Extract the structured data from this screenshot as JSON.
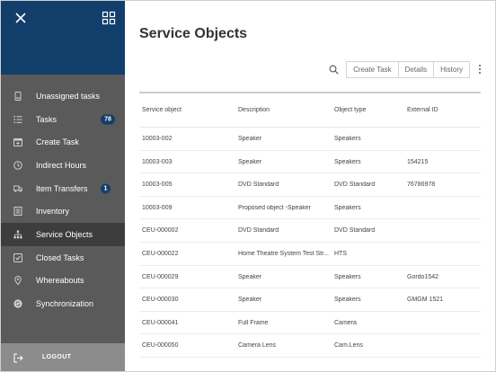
{
  "sidebar": {
    "items": [
      {
        "label": "Unassigned tasks",
        "icon": "mobile-icon",
        "badge": "",
        "active": false
      },
      {
        "label": "Tasks",
        "icon": "list-icon",
        "badge": "78",
        "active": false
      },
      {
        "label": "Create Task",
        "icon": "calendar-plus-icon",
        "badge": "",
        "active": false
      },
      {
        "label": "Indirect Hours",
        "icon": "clock-icon",
        "badge": "",
        "active": false
      },
      {
        "label": "Item Transfers",
        "icon": "truck-icon",
        "badge": "1",
        "active": false
      },
      {
        "label": "Inventory",
        "icon": "inventory-icon",
        "badge": "",
        "active": false
      },
      {
        "label": "Service Objects",
        "icon": "sitemap-icon",
        "badge": "",
        "active": true
      },
      {
        "label": "Closed Tasks",
        "icon": "check-square-icon",
        "badge": "",
        "active": false
      },
      {
        "label": "Whereabouts",
        "icon": "map-pin-icon",
        "badge": "",
        "active": false
      },
      {
        "label": "Synchronization",
        "icon": "sync-icon",
        "badge": "",
        "active": false
      }
    ],
    "logout_label": "LOGOUT"
  },
  "main": {
    "title": "Service Objects",
    "toolbar": {
      "create_task": "Create Task",
      "details": "Details",
      "history": "History"
    },
    "table": {
      "headers": [
        "Service object",
        "Description",
        "Object type",
        "External ID"
      ],
      "rows": [
        [
          "10003-002",
          "Speaker",
          "Speakers",
          ""
        ],
        [
          "10003-003",
          "Speaker",
          "Speakers",
          "154215"
        ],
        [
          "10003-005",
          "DVD Standard",
          "DVD Standard",
          "76786978"
        ],
        [
          "10003-009",
          "Proposed object -Speaker",
          "Speakers",
          ""
        ],
        [
          "CEU-000002",
          "DVD Standard",
          "DVD Standard",
          ""
        ],
        [
          "CEU-000022",
          "Home Theatre System Test Str...",
          "HTS",
          ""
        ],
        [
          "CEU-000029",
          "Speaker",
          "Speakers",
          "Gordo1542"
        ],
        [
          "CEU-000030",
          "Speaker",
          "Speakers",
          "GMGM 1521"
        ],
        [
          "CEU-000041",
          "Full Frame",
          "Camera",
          ""
        ],
        [
          "CEU-000050",
          "Camera Lens",
          "Cam.Lens",
          ""
        ]
      ]
    }
  },
  "colors": {
    "sidebar_bg": "#5a5a5a",
    "header_bg": "#123e6b",
    "active_bg": "#3d3d3d",
    "badge_bg": "#123e6b",
    "logout_bg": "#8c8c8c"
  }
}
